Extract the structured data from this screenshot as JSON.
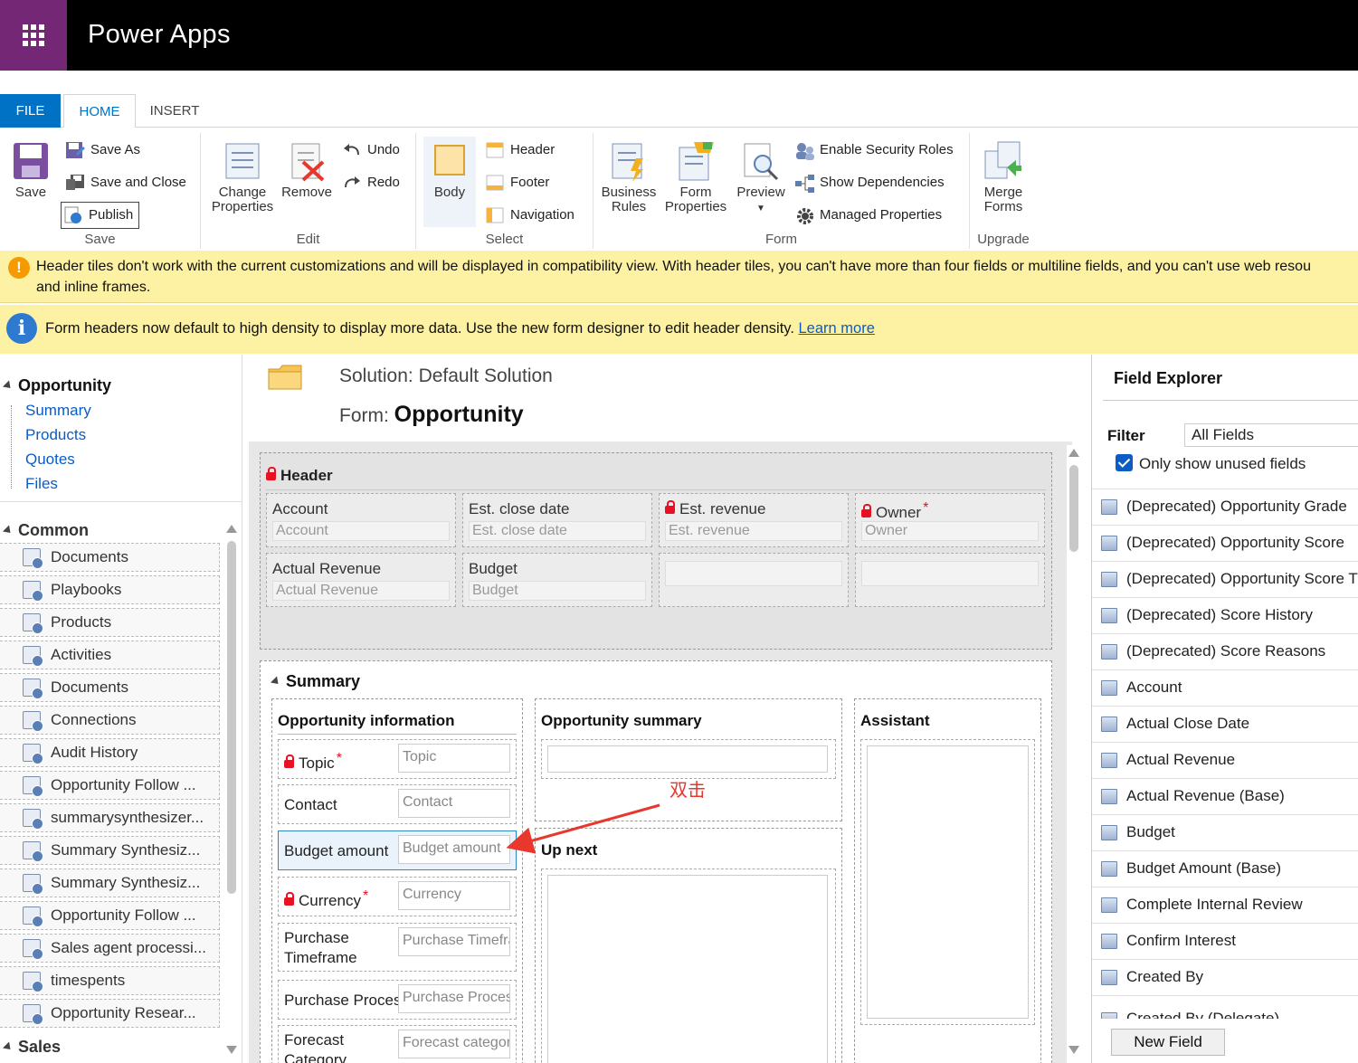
{
  "app": {
    "title": "Power Apps"
  },
  "tabs": [
    {
      "label": "FILE"
    },
    {
      "label": "HOME"
    },
    {
      "label": "INSERT"
    }
  ],
  "ribbon": {
    "save_group": {
      "save": "Save",
      "save_as": "Save As",
      "save_and_close": "Save and Close",
      "publish": "Publish",
      "label": "Save"
    },
    "edit_group": {
      "change_properties_1": "Change",
      "change_properties_2": "Properties",
      "remove": "Remove",
      "undo": "Undo",
      "redo": "Redo",
      "label": "Edit"
    },
    "select_group": {
      "body": "Body",
      "header": "Header",
      "footer": "Footer",
      "navigation": "Navigation",
      "label": "Select"
    },
    "form_group": {
      "business_rules_1": "Business",
      "business_rules_2": "Rules",
      "form_properties_1": "Form",
      "form_properties_2": "Properties",
      "preview": "Preview",
      "enable_security_roles": "Enable Security Roles",
      "show_dependencies": "Show Dependencies",
      "managed_properties": "Managed Properties",
      "label": "Form"
    },
    "upgrade_group": {
      "merge_forms_1": "Merge",
      "merge_forms_2": "Forms",
      "label": "Upgrade"
    }
  },
  "banners": {
    "warning_line1": "Header tiles don't work with the current customizations and will be displayed in compatibility view. With header tiles, you can't have more than four fields or multiline fields, and you can't use web resou",
    "warning_line2": "and inline frames.",
    "info_text": "Form headers now default to high density to display more data. Use the new form designer to edit header density.",
    "info_link": "Learn more"
  },
  "leftnav": {
    "entity": "Opportunity",
    "links": [
      "Summary",
      "Products",
      "Quotes",
      "Files"
    ],
    "common_label": "Common",
    "common_items": [
      "Documents",
      "Playbooks",
      "Products",
      "Activities",
      "Documents",
      "Connections",
      "Audit History",
      "Opportunity Follow ...",
      "summarysynthesizer...",
      "Summary Synthesiz...",
      "Summary Synthesiz...",
      "Opportunity Follow ...",
      "Sales agent processi...",
      "timespents",
      "Opportunity Resear..."
    ],
    "sales_label": "Sales"
  },
  "main": {
    "solution_prefix": "Solution:",
    "solution_name": "Default Solution",
    "form_prefix": "Form:",
    "form_name": "Opportunity",
    "header": {
      "label": "Header",
      "cells": [
        {
          "label": "Account",
          "placeholder": "Account"
        },
        {
          "label": "Est. close date",
          "placeholder": "Est. close date"
        },
        {
          "label": "Est. revenue",
          "placeholder": "Est. revenue"
        },
        {
          "label": "Owner",
          "placeholder": "Owner"
        },
        {
          "label": "Actual Revenue",
          "placeholder": "Actual Revenue"
        },
        {
          "label": "Budget",
          "placeholder": "Budget"
        }
      ]
    },
    "summary": {
      "label": "Summary",
      "opportunity_information": "Opportunity information",
      "fields": [
        {
          "label": "Topic",
          "placeholder": "Topic"
        },
        {
          "label": "Contact",
          "placeholder": "Contact"
        },
        {
          "label": "Budget amount",
          "placeholder": "Budget amount"
        },
        {
          "label": "Currency",
          "placeholder": "Currency"
        },
        {
          "label": "Purchase Timeframe",
          "placeholder": "Purchase Timefra"
        },
        {
          "label": "Purchase Process",
          "placeholder": "Purchase Process"
        },
        {
          "label": "Forecast Category",
          "placeholder": "Forecast categor"
        }
      ],
      "opportunity_summary": "Opportunity summary",
      "up_next": "Up next",
      "assistant": "Assistant"
    },
    "annotation": "双击",
    "annotation_color": "#e8372c"
  },
  "field_explorer": {
    "title": "Field Explorer",
    "filter_label": "Filter",
    "filter_value": "All Fields",
    "only_unused": "Only show unused fields",
    "fields": [
      "(Deprecated) Opportunity Grade",
      "(Deprecated) Opportunity Score",
      "(Deprecated) Opportunity Score Tre",
      "(Deprecated) Score History",
      "(Deprecated) Score Reasons",
      "Account",
      "Actual Close Date",
      "Actual Revenue",
      "Actual Revenue (Base)",
      "Budget",
      "Budget Amount (Base)",
      "Complete Internal Review",
      "Confirm Interest",
      "Created By",
      "Created By (Delegate)"
    ],
    "new_field": "New Field"
  },
  "colors": {
    "brand": "#742774",
    "accent": "#0072c6",
    "banner": "#fdf1a4",
    "required": "#e81123"
  }
}
